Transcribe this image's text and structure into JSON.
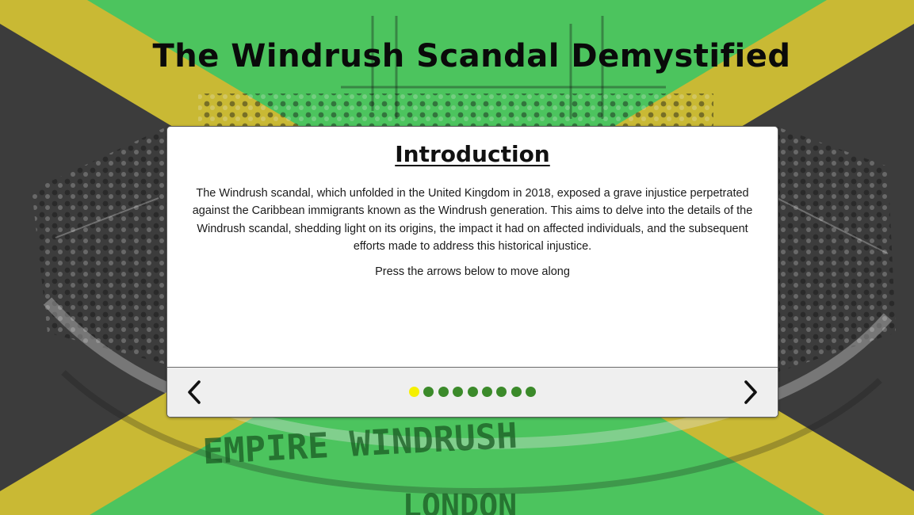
{
  "page": {
    "title": "The Windrush Scandal Demystified"
  },
  "background": {
    "ship_text_line1": "EMPIRE  WINDRUSH",
    "ship_text_line2": "LONDON"
  },
  "colors": {
    "flag_green": "#4cc45e",
    "flag_yellow": "#c9b934",
    "flag_black": "#3c3c3c",
    "dot_active": "#f5f000",
    "dot_inactive": "#3b8a2a"
  },
  "slide": {
    "heading": "Introduction",
    "body": "The Windrush scandal, which unfolded in the United Kingdom in 2018, exposed a grave injustice perpetrated against the Caribbean immigrants known as the Windrush generation. This aims to delve into the details of the Windrush scandal, shedding light on its origins, the impact it had on affected individuals, and the subsequent efforts made to address this historical injustice.",
    "hint": "Press the arrows below to move along"
  },
  "navigation": {
    "prev_icon": "chevron-left-icon",
    "next_icon": "chevron-right-icon",
    "total_slides": 9,
    "active_slide": 1
  }
}
